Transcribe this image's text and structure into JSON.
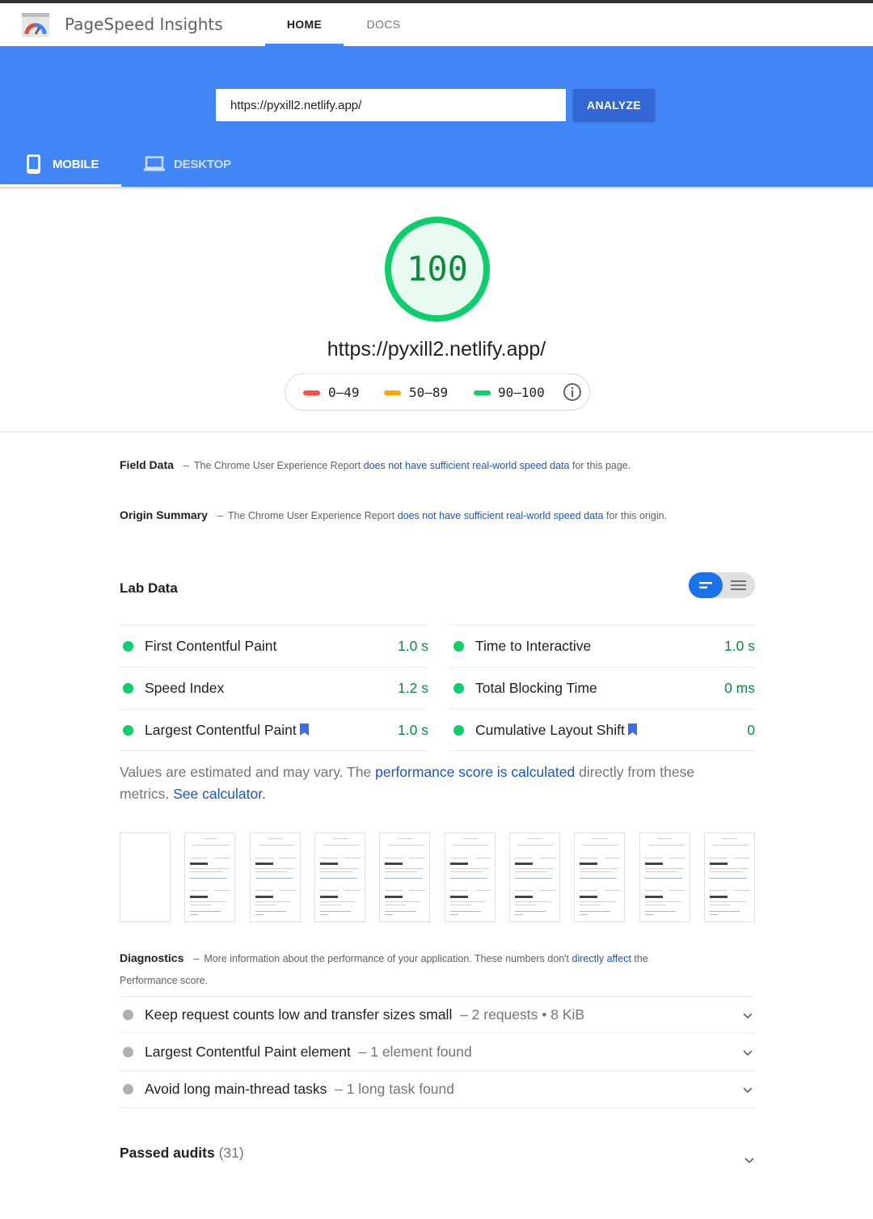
{
  "header": {
    "app_title": "PageSpeed Insights",
    "nav": [
      {
        "label": "HOME",
        "active": true
      },
      {
        "label": "DOCS",
        "active": false
      }
    ]
  },
  "analyze": {
    "url_value": "https://pyxill2.netlify.app/",
    "button_label": "ANALYZE"
  },
  "device_tabs": [
    {
      "label": "MOBILE",
      "icon": "phone-icon",
      "active": true
    },
    {
      "label": "DESKTOP",
      "icon": "laptop-icon",
      "active": false
    }
  ],
  "score": {
    "value": "100",
    "fraction": 1.0,
    "url": "https://pyxill2.netlify.app/",
    "legend": [
      {
        "range": "0–49",
        "color": "#ff4e42"
      },
      {
        "range": "50–89",
        "color": "#ffa400"
      },
      {
        "range": "90–100",
        "color": "#0cce6b"
      }
    ]
  },
  "field_data": {
    "title": "Field Data",
    "prefix": "The Chrome User Experience Report",
    "link": "does not have sufficient real-world speed data",
    "suffix": "for this page."
  },
  "origin_summary": {
    "title": "Origin Summary",
    "prefix": "The Chrome User Experience Report",
    "link": "does not have sufficient real-world speed data",
    "suffix": "for this origin."
  },
  "lab_data": {
    "title": "Lab Data",
    "metrics_left": [
      {
        "label": "First Contentful Paint",
        "value": "1.0 s",
        "bookmark": false
      },
      {
        "label": "Speed Index",
        "value": "1.2 s",
        "bookmark": false
      },
      {
        "label": "Largest Contentful Paint",
        "value": "1.0 s",
        "bookmark": true
      }
    ],
    "metrics_right": [
      {
        "label": "Time to Interactive",
        "value": "1.0 s",
        "bookmark": false
      },
      {
        "label": "Total Blocking Time",
        "value": "0 ms",
        "bookmark": false
      },
      {
        "label": "Cumulative Layout Shift",
        "value": "0",
        "bookmark": true
      }
    ],
    "estimate_prefix": "Values are estimated and may vary. The",
    "estimate_link": "performance score is calculated",
    "estimate_middle": "directly from these metrics.",
    "estimate_link2": "See calculator."
  },
  "filmstrip": {
    "frames": 10
  },
  "diagnostics": {
    "title": "Diagnostics",
    "prefix": "More information about the performance of your application. These numbers don't",
    "link": "directly affect",
    "suffix": "the Performance score.",
    "audits": [
      {
        "label": "Keep request counts low and transfer sizes small",
        "detail": "2 requests • 8 KiB"
      },
      {
        "label": "Largest Contentful Paint element",
        "detail": "1 element found"
      },
      {
        "label": "Avoid long main-thread tasks",
        "detail": "1 long task found"
      }
    ]
  },
  "passed_audits": {
    "label": "Passed audits",
    "count": "(31)"
  },
  "colors": {
    "brand_blue": "#4285f4",
    "button_blue": "#3367d6",
    "pass_green": "#0cce6b",
    "pass_text": "#0c8a3d",
    "link_blue": "#1a56c2"
  }
}
